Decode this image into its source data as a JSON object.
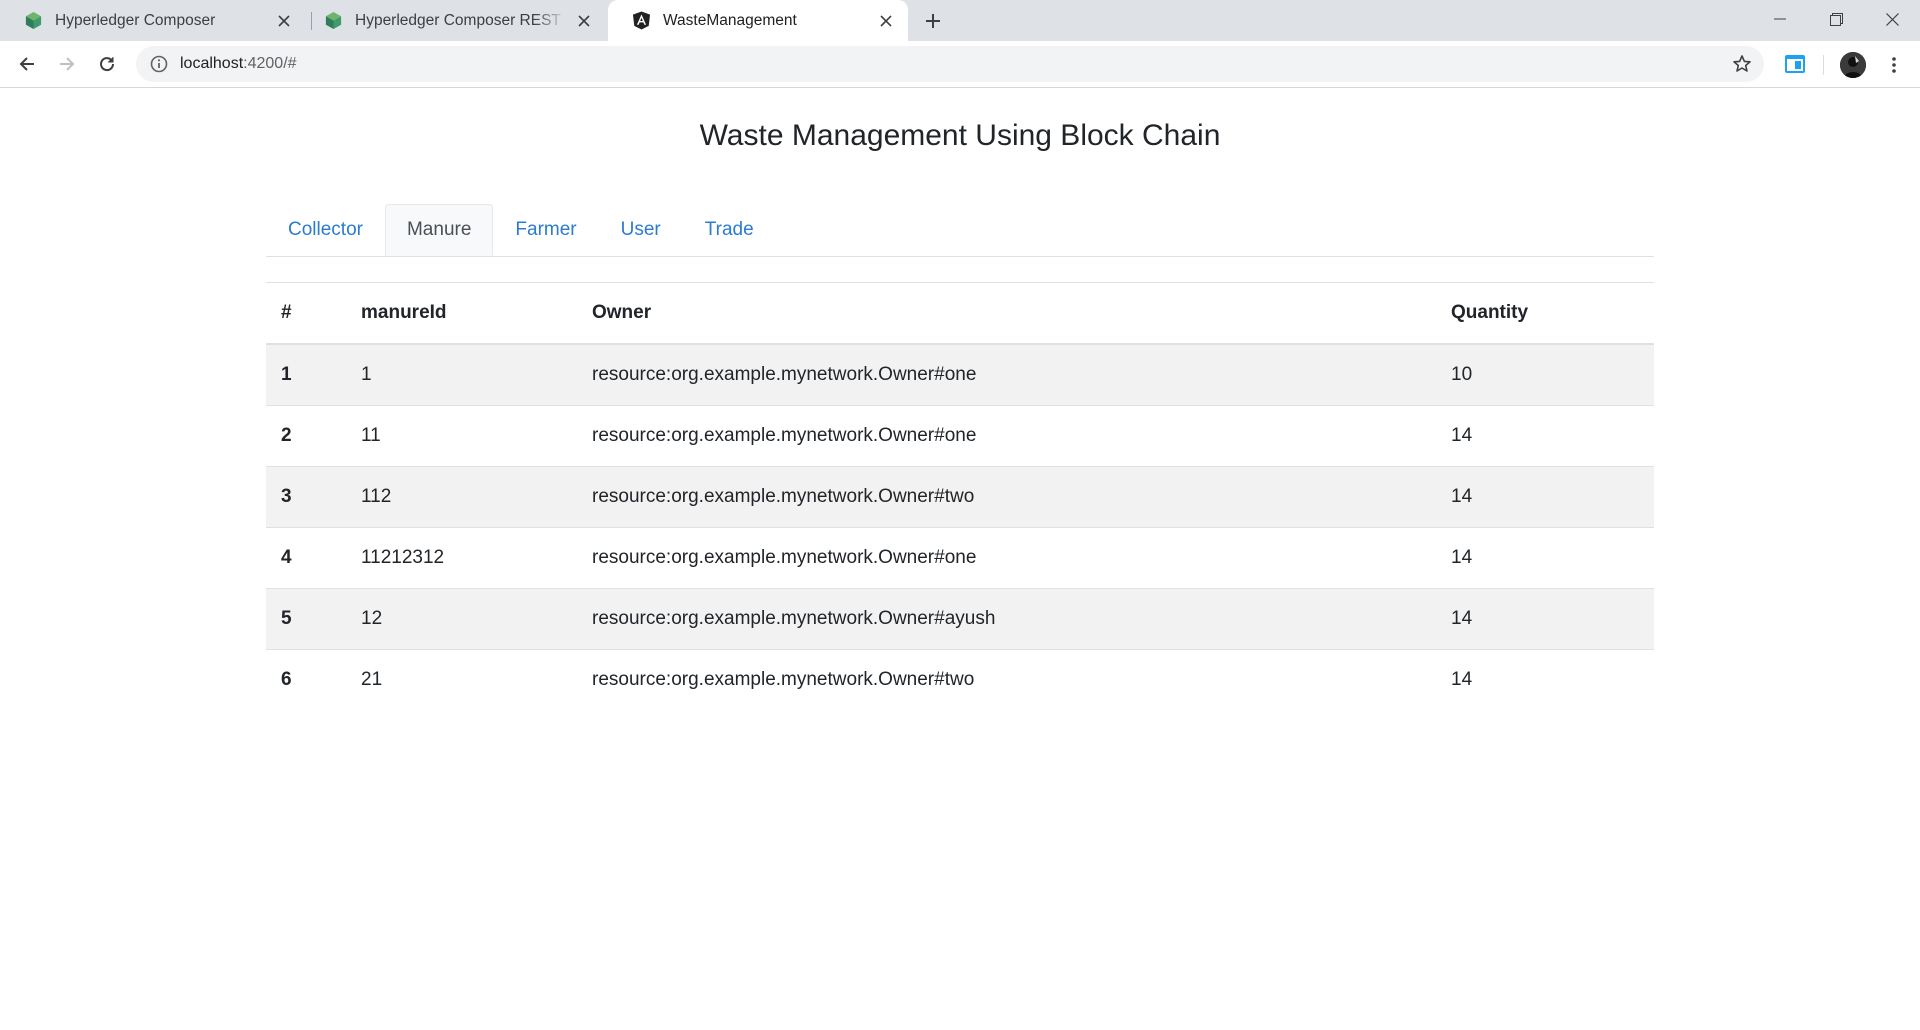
{
  "browser": {
    "tabs": [
      {
        "title": "Hyperledger Composer",
        "icon": "hyperledger-cube-icon"
      },
      {
        "title": "Hyperledger Composer REST server",
        "icon": "hyperledger-cube-icon"
      },
      {
        "title": "WasteManagement",
        "icon": "angular-icon",
        "active": true
      }
    ],
    "address": {
      "host": "localhost",
      "path": ":4200/#"
    },
    "icons": {
      "back": "arrow-left-icon",
      "forward": "arrow-right-icon",
      "reload": "reload-icon",
      "info": "info-icon",
      "bookmark": "star-icon",
      "extension": "extension-icon",
      "profile": "avatar",
      "menu": "more-vertical-icon",
      "minimize": "minimize-icon",
      "maximize": "restore-icon",
      "close": "close-icon",
      "new_tab": "plus-icon"
    }
  },
  "page": {
    "title": "Waste Management Using Block Chain",
    "nav_tabs": [
      {
        "label": "Collector"
      },
      {
        "label": "Manure",
        "active": true
      },
      {
        "label": "Farmer"
      },
      {
        "label": "User"
      },
      {
        "label": "Trade"
      }
    ],
    "table": {
      "headers": [
        "#",
        "manureId",
        "Owner",
        "Quantity"
      ],
      "rows": [
        [
          "1",
          "1",
          "resource:org.example.mynetwork.Owner#one",
          "10"
        ],
        [
          "2",
          "11",
          "resource:org.example.mynetwork.Owner#one",
          "14"
        ],
        [
          "3",
          "112",
          "resource:org.example.mynetwork.Owner#two",
          "14"
        ],
        [
          "4",
          "11212312",
          "resource:org.example.mynetwork.Owner#one",
          "14"
        ],
        [
          "5",
          "12",
          "resource:org.example.mynetwork.Owner#ayush",
          "14"
        ],
        [
          "6",
          "21",
          "resource:org.example.mynetwork.Owner#two",
          "14"
        ]
      ]
    }
  },
  "colors": {
    "link": "#2b7bd0",
    "stripe": "#f2f2f2",
    "chrome": "#dee1e6"
  }
}
